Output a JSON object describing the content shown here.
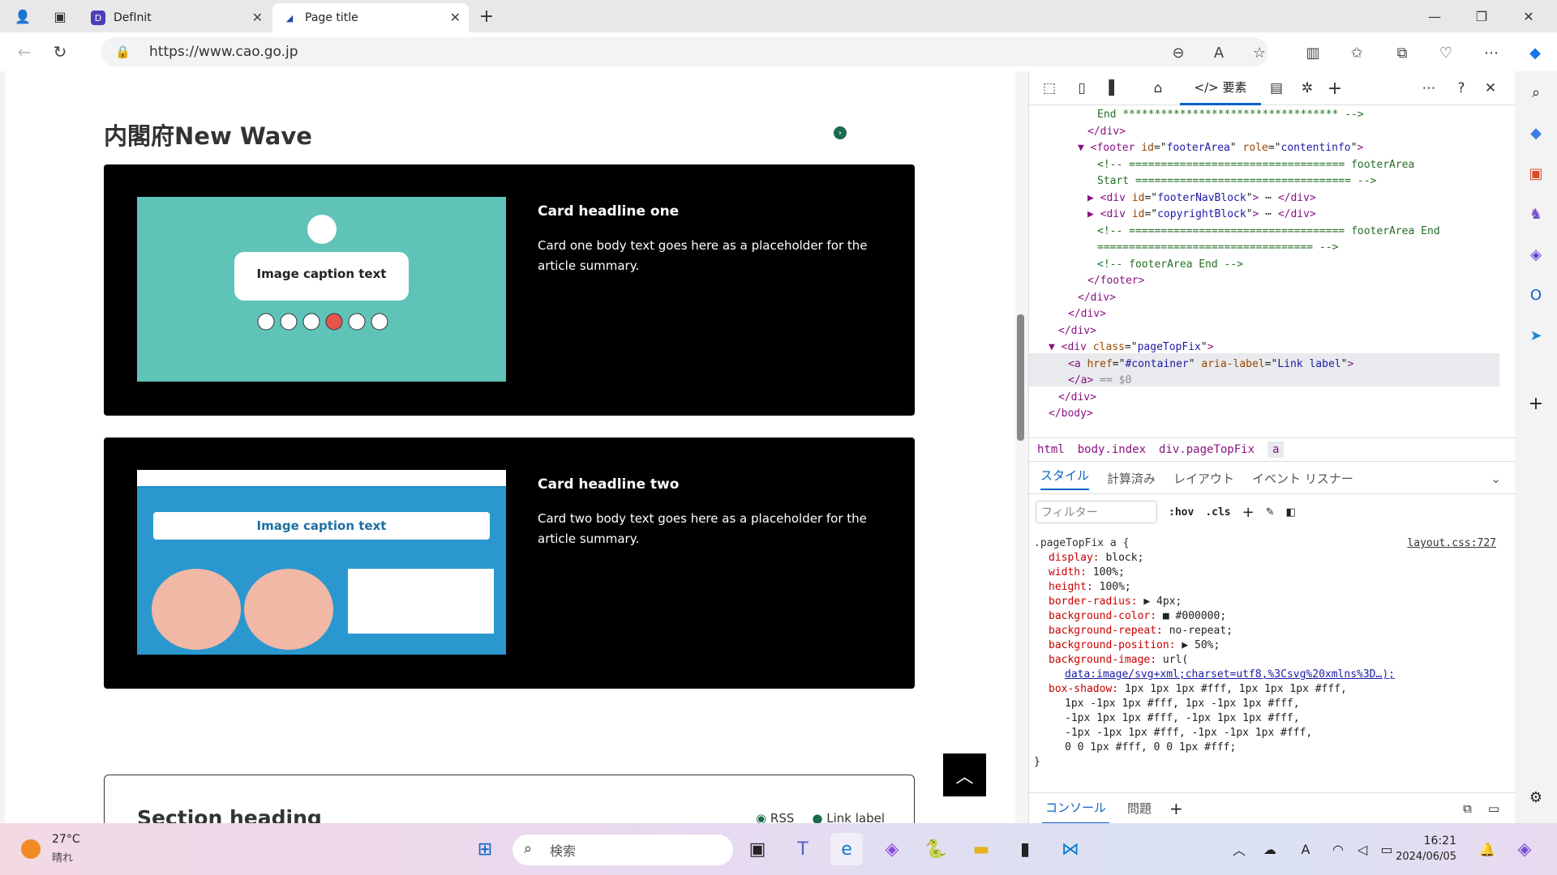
{
  "browser": {
    "tabs": [
      {
        "label": "DefInit",
        "active": false
      },
      {
        "label": "Page title",
        "active": true
      }
    ],
    "url": "https://www.cao.go.jp"
  },
  "page": {
    "section_title": "内閣府New Wave",
    "cards": [
      {
        "image_text": "Image caption text",
        "title": "Card headline one",
        "body": "Card one body text goes here as a placeholder for the article summary."
      },
      {
        "image_text": "Image caption text",
        "title": "Card headline two",
        "body": "Card two body text goes here as a placeholder for the article summary."
      }
    ],
    "press": {
      "title": "Section heading",
      "rss": "RSS",
      "list_link": "Link label"
    }
  },
  "devtools": {
    "elements_tab": "要素",
    "dom_lines": [
      {
        "html": "<span class='cmt'>End ********************************** --></span>",
        "indent": 7
      },
      {
        "html": "<span class='tag'>&lt;/div&gt;</span>",
        "indent": 6
      },
      {
        "html": "<span class='tag'>▼ &lt;footer</span> <span class='attr'>id</span>=\"<span class='val'>footerArea</span>\" <span class='attr'>role</span>=\"<span class='val'>contentinfo</span>\"<span class='tag'>&gt;</span>",
        "indent": 5
      },
      {
        "html": "<span class='cmt'>&lt;!-- ================================== footerArea</span>",
        "indent": 7
      },
      {
        "html": "<span class='cmt'>Start ================================== --></span>",
        "indent": 7
      },
      {
        "html": "<span class='tag'>▶ &lt;div</span> <span class='attr'>id</span>=\"<span class='val'>footerNavBlock</span>\"<span class='tag'>&gt;</span> ⋯ <span class='tag'>&lt;/div&gt;</span>",
        "indent": 6
      },
      {
        "html": "<span class='tag'>▶ &lt;div</span> <span class='attr'>id</span>=\"<span class='val'>copyrightBlock</span>\"<span class='tag'>&gt;</span> ⋯ <span class='tag'>&lt;/div&gt;</span>",
        "indent": 6
      },
      {
        "html": "<span class='cmt'>&lt;!-- ================================== footerArea End</span>",
        "indent": 7
      },
      {
        "html": "<span class='cmt'>================================== --></span>",
        "indent": 7
      },
      {
        "html": "<span class='cmt'>&lt;!-- footerArea End --></span>",
        "indent": 7
      },
      {
        "html": "<span class='tag'>&lt;/footer&gt;</span>",
        "indent": 6
      },
      {
        "html": "<span class='tag'>&lt;/div&gt;</span>",
        "indent": 5
      },
      {
        "html": "<span class='tag'>&lt;/div&gt;</span>",
        "indent": 4
      },
      {
        "html": "<span class='tag'>&lt;/div&gt;</span>",
        "indent": 3
      },
      {
        "html": "<span class='tag'>▼ &lt;div</span> <span class='attr'>class</span>=\"<span class='val'>pageTopFix</span>\"<span class='tag'>&gt;</span>",
        "indent": 2
      },
      {
        "html": "<span class='tag'>&lt;a</span> <span class='attr'>href</span>=\"<span class='val'>#container</span>\" <span class='attr'>aria-label</span>=\"<span class='val'>Link label</span>\"<span class='tag'>&gt;</span>",
        "indent": 4
      },
      {
        "html": "<span class='tag'>&lt;/a&gt;</span> <span style='color:#888'>== $0</span>",
        "indent": 4
      },
      {
        "html": "<span class='tag'>&lt;/div&gt;</span>",
        "indent": 3
      },
      {
        "html": "<span class='tag'>&lt;/body&gt;</span>",
        "indent": 2
      }
    ],
    "breadcrumbs": [
      "html",
      "body.index",
      "div.pageTopFix",
      "a"
    ],
    "style_tabs": [
      "スタイル",
      "計算済み",
      "レイアウト",
      "イベント リスナー"
    ],
    "filter_placeholder": "フィルター",
    "hov": ":hov",
    "cls": ".cls",
    "rule_selector": ".pageTopFix a {",
    "rule_source": "layout.css:727",
    "rule_props": [
      {
        "name": "display",
        "value": "block;"
      },
      {
        "name": "width",
        "value": "100%;"
      },
      {
        "name": "height",
        "value": "100%;"
      },
      {
        "name": "border-radius",
        "value": "▶ 4px;"
      },
      {
        "name": "background-color",
        "value": "■ #000000;"
      },
      {
        "name": "background-repeat",
        "value": "no-repeat;"
      },
      {
        "name": "background-position",
        "value": "▶ 50%;"
      },
      {
        "name": "background-image",
        "value": "url("
      },
      {
        "name": "",
        "value": "data:image/svg+xml;charset=utf8,%3Csvg%20xmlns%3D…);"
      },
      {
        "name": "box-shadow",
        "value": "1px 1px 1px #fff, 1px 1px 1px #fff,"
      },
      {
        "name": "",
        "value": "1px -1px 1px #fff, 1px -1px 1px #fff,"
      },
      {
        "name": "",
        "value": "-1px 1px 1px #fff, -1px 1px 1px #fff,"
      },
      {
        "name": "",
        "value": "-1px -1px 1px #fff, -1px -1px 1px #fff,"
      },
      {
        "name": "",
        "value": "0 0 1px #fff, 0 0 1px #fff;"
      }
    ],
    "drawer_tabs": [
      "コンソール",
      "問題"
    ]
  },
  "taskbar": {
    "weather_temp": "27°C",
    "weather_desc": "晴れ",
    "search_placeholder": "検索",
    "time": "16:21",
    "date": "2024/06/05"
  },
  "colors": {
    "accent": "#0a63c9",
    "card_bg": "#000000",
    "thumb1_bg": "#5fc3b8",
    "thumb2_header": "#1d8fc7"
  }
}
